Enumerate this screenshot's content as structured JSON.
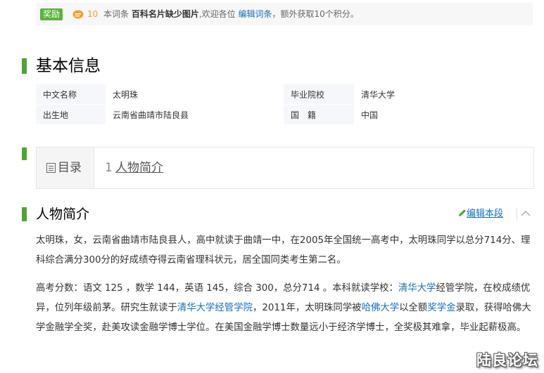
{
  "reward": {
    "badge": "奖励",
    "coins": "10",
    "text_prefix": "本词条",
    "text_bold": "百科名片缺少图片",
    "text_middle": ",欢迎各位",
    "edit_link": "编辑词条",
    "text_suffix": "，额外获取10个积分。"
  },
  "basic_info": {
    "title": "基本信息",
    "rows": [
      {
        "k1": "中文名称",
        "v1": "太明珠",
        "k2": "毕业院校",
        "v2": "清华大学"
      },
      {
        "k1": "出生地",
        "v1": "云南省曲靖市陆良县",
        "k2": "国　籍",
        "v2": "中国"
      }
    ]
  },
  "toc": {
    "title": "目录",
    "items": [
      {
        "num": "1",
        "label": "人物简介"
      }
    ]
  },
  "section": {
    "title": "人物简介",
    "edit_label": "编辑本段"
  },
  "paragraphs": {
    "p1": "太明珠，女，云南省曲靖市陆良县人，高中就读于曲靖一中，在2005年全国统一高考中，太明珠同学以总分714分、理科综合满分300分的好成绩夺得云南省理科状元，居全国同类考生第二名。",
    "p2_a": "高考分数：语文 125 ，数学 144，英语 145，综合 300，总分714 。本科就读学校：",
    "p2_link1": "清华大学",
    "p2_b": "经管学院，在校成绩优异，位列年级前茅。研究生就读于",
    "p2_link2": "清华大学经管学院",
    "p2_c": "，2011年，太明珠同学被",
    "p2_link3": "哈佛大学",
    "p2_d": "以全额",
    "p2_link4": "奖学金",
    "p2_e": "录取，获得哈佛大学金融学全奖，赴美攻读金融学博士学位。在美国金融学博士数量远小于经济学博士，全奖极其难拿，毕业起薪极高。"
  },
  "watermark": "陆良论坛",
  "colors": {
    "accent_green": "#4ca530",
    "link_blue": "#136ec2",
    "coin_orange": "#f0a22b"
  }
}
